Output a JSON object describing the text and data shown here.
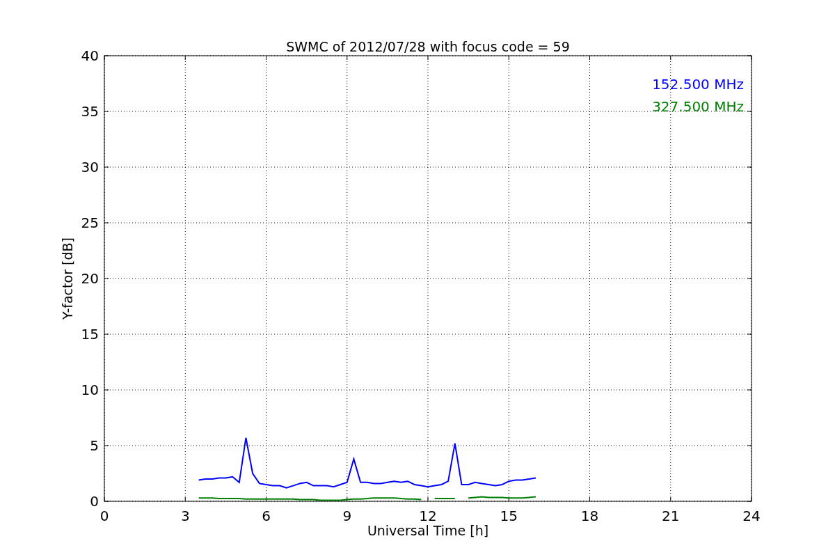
{
  "chart_data": {
    "type": "line",
    "title": "SWMC of 2012/07/28 with focus code = 59",
    "xlabel": "Universal Time [h]",
    "ylabel": "Y-factor [dB]",
    "x": [
      3.5,
      3.75,
      4,
      4.25,
      4.5,
      4.75,
      5,
      5.25,
      5.5,
      5.75,
      6,
      6.25,
      6.5,
      6.75,
      7,
      7.25,
      7.5,
      7.75,
      8,
      8.25,
      8.5,
      8.75,
      9,
      9.25,
      9.5,
      9.75,
      10,
      10.25,
      10.5,
      10.75,
      11,
      11.25,
      11.5,
      11.75,
      12,
      12.25,
      12.5,
      12.75,
      13,
      13.25,
      13.5,
      13.75,
      14,
      14.25,
      14.5,
      14.75,
      15,
      15.25,
      15.5,
      15.75,
      16
    ],
    "series": [
      {
        "name": "152.500 MHz",
        "color": "#0000ff",
        "values": [
          1.9,
          2.0,
          2.0,
          2.1,
          2.1,
          2.2,
          1.7,
          5.7,
          2.5,
          1.6,
          1.5,
          1.4,
          1.4,
          1.2,
          1.4,
          1.6,
          1.7,
          1.4,
          1.4,
          1.4,
          1.3,
          1.5,
          1.7,
          3.8,
          1.7,
          1.7,
          1.6,
          1.6,
          1.7,
          1.8,
          1.7,
          1.8,
          1.5,
          1.4,
          1.3,
          1.4,
          1.5,
          1.8,
          5.2,
          1.5,
          1.5,
          1.7,
          1.6,
          1.5,
          1.4,
          1.5,
          1.8,
          1.9,
          1.9,
          2.0,
          2.1
        ]
      },
      {
        "name": "327.500 MHz",
        "color": "#008000",
        "values": [
          0.3,
          0.3,
          0.3,
          0.25,
          0.25,
          0.25,
          0.25,
          0.2,
          0.2,
          0.2,
          0.2,
          0.2,
          0.2,
          0.2,
          0.2,
          0.15,
          0.15,
          0.15,
          0.1,
          0.1,
          0.1,
          0.1,
          0.15,
          0.2,
          0.2,
          0.25,
          0.3,
          0.3,
          0.3,
          0.3,
          0.25,
          0.2,
          0.2,
          0.15,
          null,
          0.25,
          0.25,
          0.25,
          0.25,
          null,
          0.3,
          0.35,
          0.4,
          0.35,
          0.35,
          0.35,
          0.3,
          0.3,
          0.3,
          0.35,
          0.4
        ]
      }
    ],
    "grid": true,
    "xlim": [
      0,
      24
    ],
    "ylim": [
      0,
      40
    ],
    "xticks": [
      0,
      3,
      6,
      9,
      12,
      15,
      18,
      21,
      24
    ],
    "yticks": [
      0,
      5,
      10,
      15,
      20,
      25,
      30,
      35,
      40
    ]
  }
}
